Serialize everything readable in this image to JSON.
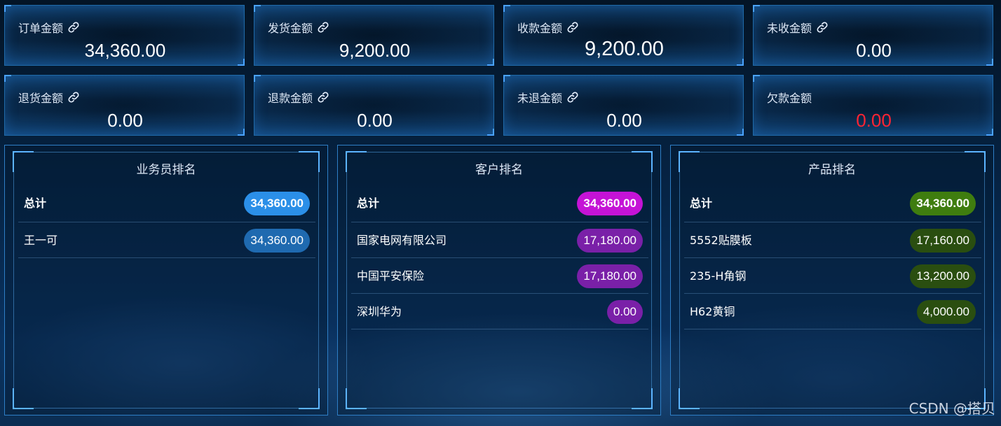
{
  "stats": [
    {
      "label": "订单金额",
      "value": "34,360.00",
      "link": true,
      "big": false,
      "red": false
    },
    {
      "label": "发货金额",
      "value": "9,200.00",
      "link": true,
      "big": false,
      "red": false
    },
    {
      "label": "收款金额",
      "value": "9,200.00",
      "link": true,
      "big": true,
      "red": false
    },
    {
      "label": "未收金额",
      "value": "0.00",
      "link": true,
      "big": false,
      "red": false
    },
    {
      "label": "退货金额",
      "value": "0.00",
      "link": true,
      "big": false,
      "red": false
    },
    {
      "label": "退款金额",
      "value": "0.00",
      "link": true,
      "big": false,
      "red": false
    },
    {
      "label": "未退金额",
      "value": "0.00",
      "link": true,
      "big": false,
      "red": false
    },
    {
      "label": "欠款金额",
      "value": "0.00",
      "link": false,
      "big": false,
      "red": true
    }
  ],
  "panels": [
    {
      "title": "业务员排名",
      "rows": [
        {
          "name": "总计",
          "value": "34,360.00",
          "total": true,
          "color": "#2b8fe8"
        },
        {
          "name": "王一可",
          "value": "34,360.00",
          "total": false,
          "color": "#1f6ab0"
        }
      ]
    },
    {
      "title": "客户排名",
      "rows": [
        {
          "name": "总计",
          "value": "34,360.00",
          "total": true,
          "color": "#c513d6"
        },
        {
          "name": "国家电网有限公司",
          "value": "17,180.00",
          "total": false,
          "color": "#7a20a8"
        },
        {
          "name": "中国平安保险",
          "value": "17,180.00",
          "total": false,
          "color": "#7a20a8"
        },
        {
          "name": "深圳华为",
          "value": "0.00",
          "total": false,
          "color": "#7a20a8"
        }
      ]
    },
    {
      "title": "产品排名",
      "rows": [
        {
          "name": "总计",
          "value": "34,360.00",
          "total": true,
          "color": "#3f7d0f"
        },
        {
          "name": "5552贴膜板",
          "value": "17,160.00",
          "total": false,
          "color": "#2a4e10"
        },
        {
          "name": "235-H角钢",
          "value": "13,200.00",
          "total": false,
          "color": "#2a4e10"
        },
        {
          "name": "H62黄铜",
          "value": "4,000.00",
          "total": false,
          "color": "#2a4e10"
        }
      ]
    }
  ],
  "watermark": "CSDN @搭贝",
  "icons": {
    "link": "link-icon"
  }
}
